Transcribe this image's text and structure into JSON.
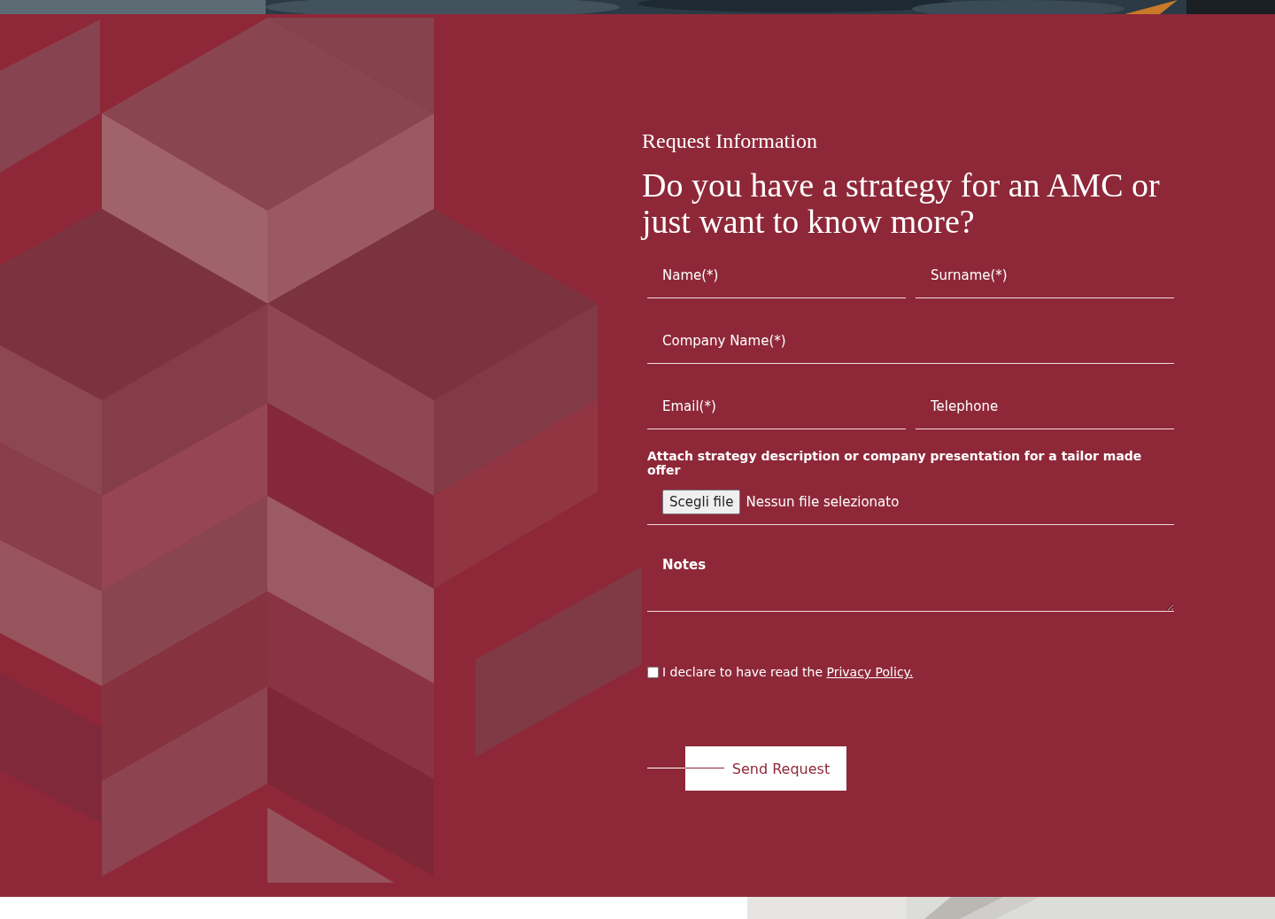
{
  "eyebrow": "Request Information",
  "heading": "Do you have a strategy for an AMC or just want to know more?",
  "field_rows": [
    [
      {
        "placeholder": "Name(*)"
      },
      {
        "placeholder": "Surname(*)"
      }
    ],
    [
      {
        "placeholder": "Company Name(*)"
      }
    ],
    [
      {
        "placeholder": "Email(*)"
      },
      {
        "placeholder": "Telephone"
      }
    ]
  ],
  "attachment": {
    "label": "Attach strategy description or company presentation for a tailor made offer",
    "button": "Scegli file",
    "status": "Nessun file selezionato"
  },
  "notes": {
    "placeholder": "Notes"
  },
  "consent": {
    "checked": false,
    "text": "I declare to have read the",
    "link": "Privacy Policy."
  },
  "submit": "Send Request"
}
